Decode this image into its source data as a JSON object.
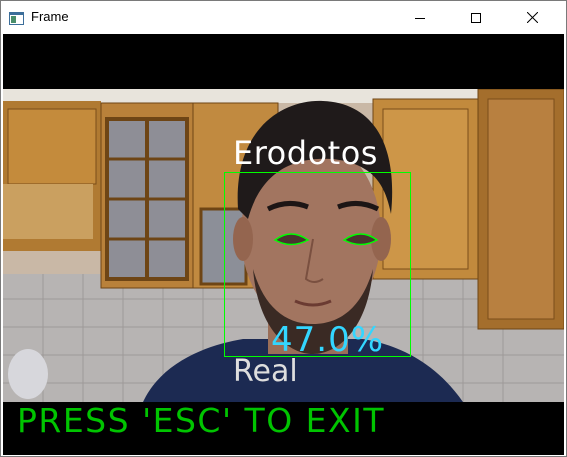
{
  "window": {
    "title": "Frame",
    "icon": "app-window-icon",
    "controls": [
      "minimize-icon",
      "maximize-icon",
      "close-icon"
    ]
  },
  "overlay": {
    "person_name": "Erodotos",
    "confidence": "47.0%",
    "liveness": "Real",
    "instruction": "PRESS 'ESC' TO EXIT"
  },
  "colors": {
    "face_box": "#00ff00",
    "confidence_text": "#33d6ff",
    "instruction_text": "#00c400",
    "name_text": "#ffffff"
  }
}
